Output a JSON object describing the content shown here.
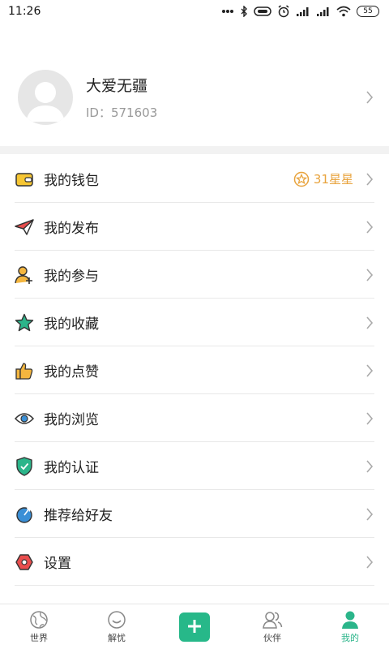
{
  "status_bar": {
    "time": "11:26",
    "battery": "55"
  },
  "profile": {
    "name": "大爱无疆",
    "id_text": "ID：571603"
  },
  "menu": {
    "items": [
      {
        "label": "我的钱包",
        "icon": "wallet-icon"
      },
      {
        "label": "我的发布",
        "icon": "paper-plane-icon"
      },
      {
        "label": "我的参与",
        "icon": "user-plus-icon"
      },
      {
        "label": "我的收藏",
        "icon": "star-icon"
      },
      {
        "label": "我的点赞",
        "icon": "thumbs-up-icon"
      },
      {
        "label": "我的浏览",
        "icon": "eye-icon"
      },
      {
        "label": "我的认证",
        "icon": "shield-check-icon"
      },
      {
        "label": "推荐给好友",
        "icon": "share-icon"
      },
      {
        "label": "设置",
        "icon": "settings-hexagon-icon"
      }
    ],
    "wallet_stars": "31星星"
  },
  "tabbar": {
    "tabs": [
      {
        "label": "世界",
        "icon": "globe-icon"
      },
      {
        "label": "解忧",
        "icon": "smile-icon"
      },
      {
        "label": "",
        "icon": "add-icon"
      },
      {
        "label": "伙伴",
        "icon": "partners-icon"
      },
      {
        "label": "我的",
        "icon": "person-icon"
      }
    ],
    "active_index": 4
  },
  "colors": {
    "accent": "#27b889",
    "star_gold": "#e8a33d",
    "divider": "#f2f2f2"
  }
}
